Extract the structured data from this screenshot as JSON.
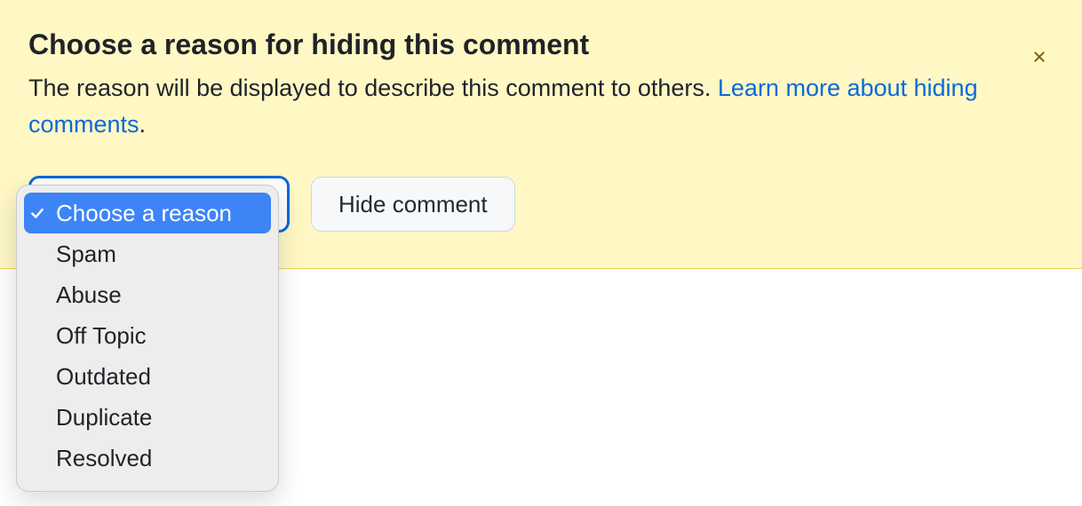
{
  "banner": {
    "title": "Choose a reason for hiding this comment",
    "subtitle_prefix": "The reason will be displayed to describe this comment to others. ",
    "link_text": "Learn more about hiding comments",
    "subtitle_suffix": "."
  },
  "controls": {
    "hide_button": "Hide comment"
  },
  "dropdown": {
    "selected_index": 0,
    "options": [
      {
        "label": "Choose a reason"
      },
      {
        "label": "Spam"
      },
      {
        "label": "Abuse"
      },
      {
        "label": "Off Topic"
      },
      {
        "label": "Outdated"
      },
      {
        "label": "Duplicate"
      },
      {
        "label": "Resolved"
      }
    ]
  }
}
